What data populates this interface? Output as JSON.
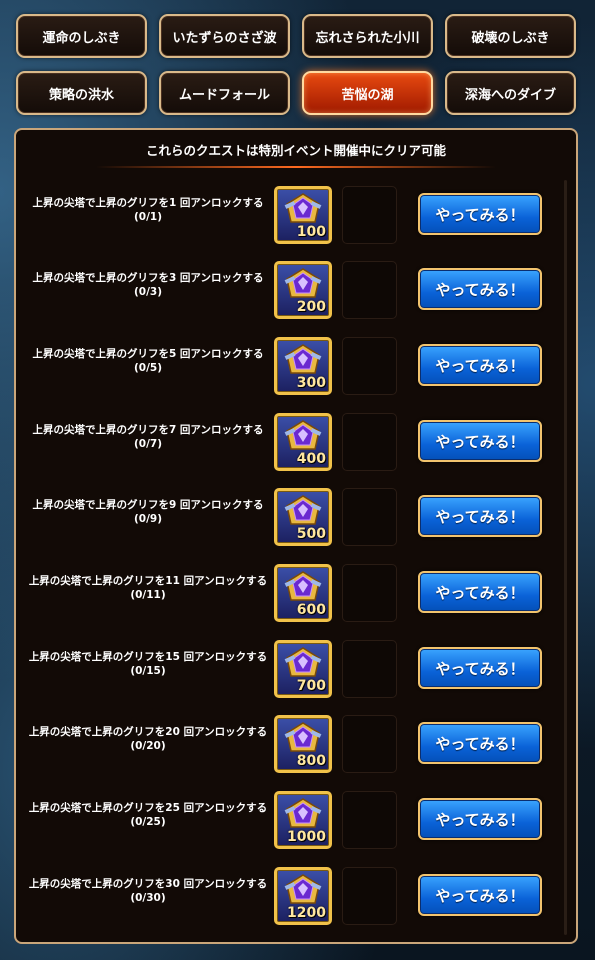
{
  "tabs": [
    {
      "label": "運命のしぶき",
      "active": false
    },
    {
      "label": "いたずらのさざ波",
      "active": false
    },
    {
      "label": "忘れさられた小川",
      "active": false
    },
    {
      "label": "破壊のしぶき",
      "active": false
    },
    {
      "label": "策略の洪水",
      "active": false
    },
    {
      "label": "ムードフォール",
      "active": false
    },
    {
      "label": "苦悩の湖",
      "active": true
    },
    {
      "label": "深海へのダイブ",
      "active": false
    }
  ],
  "panel": {
    "title": "これらのクエストは特別イベント開催中にクリア可能"
  },
  "quests": [
    {
      "title": "上昇の尖塔で上昇のグリフを1 回アンロックする",
      "progress": "(0/1)",
      "reward": "100",
      "button": "やってみる！"
    },
    {
      "title": "上昇の尖塔で上昇のグリフを3 回アンロックする",
      "progress": "(0/3)",
      "reward": "200",
      "button": "やってみる！"
    },
    {
      "title": "上昇の尖塔で上昇のグリフを5 回アンロックする",
      "progress": "(0/5)",
      "reward": "300",
      "button": "やってみる！"
    },
    {
      "title": "上昇の尖塔で上昇のグリフを7 回アンロックする",
      "progress": "(0/7)",
      "reward": "400",
      "button": "やってみる！"
    },
    {
      "title": "上昇の尖塔で上昇のグリフを9 回アンロックする",
      "progress": "(0/9)",
      "reward": "500",
      "button": "やってみる！"
    },
    {
      "title": "上昇の尖塔で上昇のグリフを11 回アンロックする",
      "progress": "(0/11)",
      "reward": "600",
      "button": "やってみる！"
    },
    {
      "title": "上昇の尖塔で上昇のグリフを15 回アンロックする",
      "progress": "(0/15)",
      "reward": "700",
      "button": "やってみる！"
    },
    {
      "title": "上昇の尖塔で上昇のグリフを20 回アンロックする",
      "progress": "(0/20)",
      "reward": "800",
      "button": "やってみる！"
    },
    {
      "title": "上昇の尖塔で上昇のグリフを25 回アンロックする",
      "progress": "(0/25)",
      "reward": "1000",
      "button": "やってみる！"
    },
    {
      "title": "上昇の尖塔で上昇のグリフを30 回アンロックする",
      "progress": "(0/30)",
      "reward": "1200",
      "button": "やってみる！"
    }
  ],
  "icons": {
    "reward_icon": "glyph-chest-icon"
  },
  "colors": {
    "active_tab": "#e84a10",
    "button_blue": "#0a62d8",
    "gold_border": "#f1c24a"
  }
}
